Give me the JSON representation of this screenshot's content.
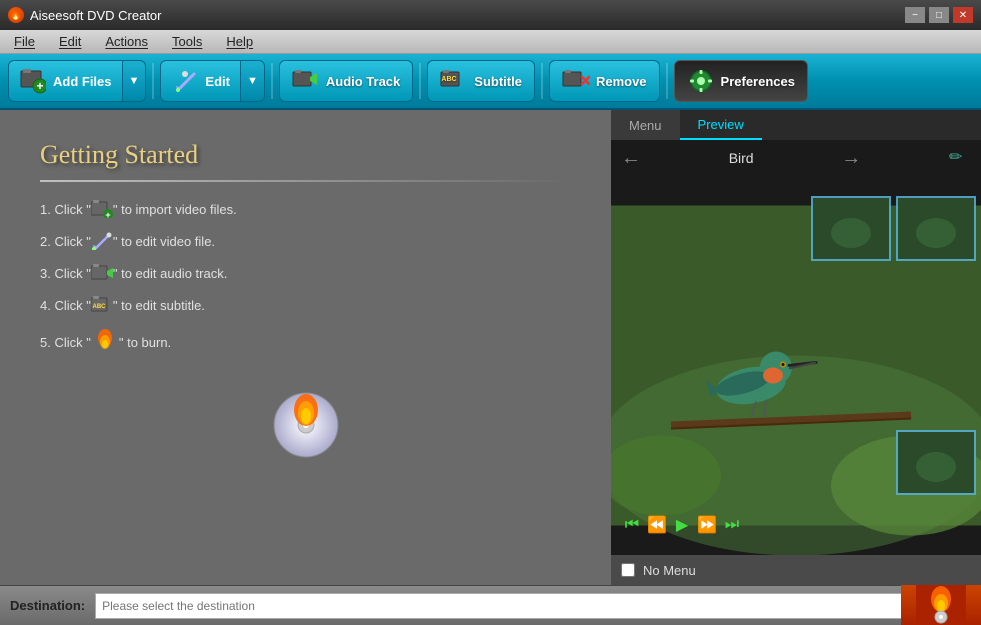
{
  "app": {
    "title": "Aiseesoft DVD Creator"
  },
  "titlebar": {
    "minimize": "−",
    "maximize": "□",
    "close": "✕"
  },
  "menubar": {
    "items": [
      "File",
      "Edit",
      "Actions",
      "Tools",
      "Help"
    ]
  },
  "toolbar": {
    "add_files": "Add Files",
    "edit": "Edit",
    "audio_track": "Audio Track",
    "subtitle": "Subtitle",
    "remove": "Remove",
    "preferences": "Preferences"
  },
  "getting_started": {
    "title": "Getting Started",
    "steps": [
      {
        "number": "1.",
        "prefix": "Click \"",
        "suffix": "\" to import video files.",
        "icon": "film-add"
      },
      {
        "number": "2.",
        "prefix": "Click \"",
        "suffix": "\" to edit video file.",
        "icon": "edit-tool"
      },
      {
        "number": "3.",
        "prefix": "Click \"",
        "suffix": "\" to edit audio track.",
        "icon": "audio-film"
      },
      {
        "number": "4.",
        "prefix": "Click \"",
        "suffix": "\" to edit subtitle.",
        "icon": "subtitle-film"
      },
      {
        "number": "5.",
        "prefix": "Click \"",
        "suffix": "\" to burn.",
        "icon": "fire"
      }
    ]
  },
  "preview": {
    "tabs": [
      "Menu",
      "Preview"
    ],
    "active_tab": "Preview",
    "title": "Bird",
    "no_menu_label": "No Menu",
    "no_menu_checked": false
  },
  "playback": {
    "buttons": [
      "⏮",
      "⏪",
      "▶",
      "⏩",
      "⏭"
    ]
  },
  "bottom": {
    "destination_label": "Destination:",
    "destination_placeholder": "Please select the destination",
    "dropdown_arrow": "▼"
  }
}
